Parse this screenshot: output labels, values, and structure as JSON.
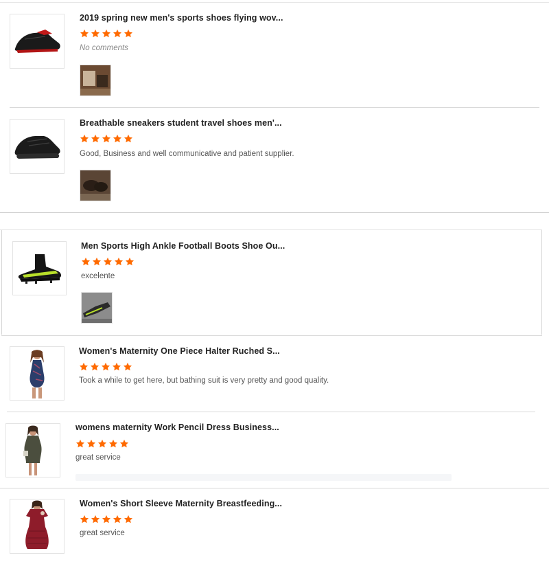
{
  "colors": {
    "star": "#ff6a00",
    "divider": "#d9d9d9",
    "title": "#222222",
    "comment": "#555555"
  },
  "reviews": [
    {
      "title": "2019 spring new men's sports shoes flying wov...",
      "rating": 5,
      "comment": "No comments",
      "has_photo": true,
      "product_icon": "black-red-sneaker-icon",
      "photo_icon": "customer-photo-icon"
    },
    {
      "title": "Breathable sneakers student travel shoes men'...",
      "rating": 5,
      "comment": "Good, Business and well communicative and patient supplier.",
      "has_photo": true,
      "product_icon": "black-sneaker-icon",
      "photo_icon": "customer-photo-icon"
    },
    {
      "title": "Men Sports High Ankle Football Boots Shoe Ou...",
      "rating": 5,
      "comment": "excelente",
      "has_photo": true,
      "product_icon": "football-boot-icon",
      "photo_icon": "customer-photo-icon"
    },
    {
      "title": "Women's Maternity One Piece Halter Ruched S...",
      "rating": 5,
      "comment": "Took a while to get here, but bathing suit is very pretty and good quality.",
      "has_photo": false,
      "product_icon": "maternity-swimsuit-icon"
    },
    {
      "title": "womens maternity Work Pencil Dress Business...",
      "rating": 5,
      "comment": "great service",
      "has_photo": false,
      "product_icon": "maternity-dress-icon"
    },
    {
      "title": "Women's Short Sleeve Maternity Breastfeeding...",
      "rating": 5,
      "comment": "great service",
      "has_photo": false,
      "product_icon": "red-maternity-dress-icon"
    }
  ]
}
